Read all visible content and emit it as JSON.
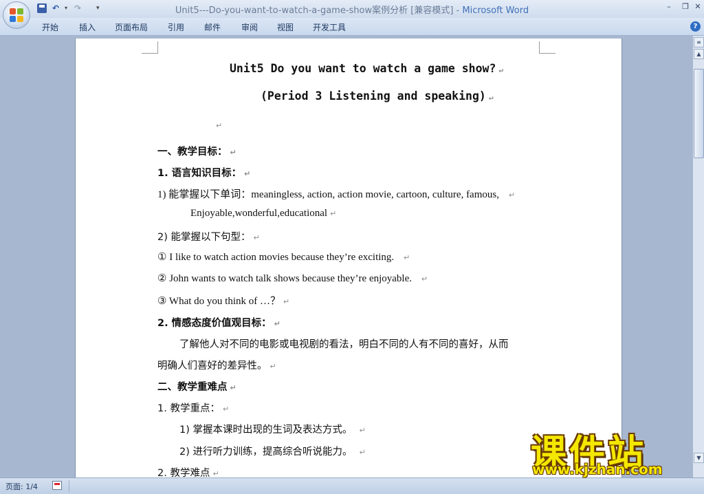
{
  "window": {
    "title_doc": "Unit5---Do-you-want-to-watch-a-game-show案例分析 [兼容模式]",
    "title_sep": " - ",
    "title_app": "Microsoft Word",
    "minimize": "–",
    "restore": "❐",
    "close": "✕"
  },
  "quick_access": {
    "undo": "↶",
    "undo_dropdown": "▾",
    "redo": "↷",
    "customize": "▾"
  },
  "ribbon": {
    "tabs": [
      "开始",
      "插入",
      "页面布局",
      "引用",
      "邮件",
      "审阅",
      "视图",
      "开发工具"
    ],
    "help": "?"
  },
  "document": {
    "title": "Unit5   Do you want to watch a game show?",
    "subtitle": "(Period 3 Listening and speaking)",
    "para_mark": "↵",
    "lines": {
      "h1": "一、教学目标：",
      "h1_1": "1. 语言知识目标：",
      "item1": "1) 能掌握以下单词：meaningless, action, action movie, cartoon, culture, famous,",
      "item1_cont": "Enjoyable,wonderful,educational",
      "item2": "2) 能掌握以下句型：",
      "s1": "① I like to watch action movies because they’re exciting.",
      "s2": "② John wants to watch talk shows because they’re enjoyable.",
      "s3": "③  What do you think of …？",
      "h1_2": "2. 情感态度价值观目标：",
      "p1": "了解他人对不同的电影或电视剧的看法，明白不同的人有不同的喜好，从而",
      "p1_cont": "明确人们喜好的差异性。",
      "h2": "二、教学重难点",
      "k1": "1. 教学重点：",
      "k1_1": "1) 掌握本课时出现的生词及表达方式。",
      "k1_2": "2) 进行听力训练，提高综合听说能力。",
      "k2": "2. 教学难点"
    }
  },
  "scrollbar": {
    "up": "▲",
    "down": "▼",
    "view_toggle": "≡"
  },
  "status": {
    "page": "页面: 1/4"
  },
  "watermark": {
    "brand": "课件站",
    "url": "www.kjzhan.com"
  }
}
